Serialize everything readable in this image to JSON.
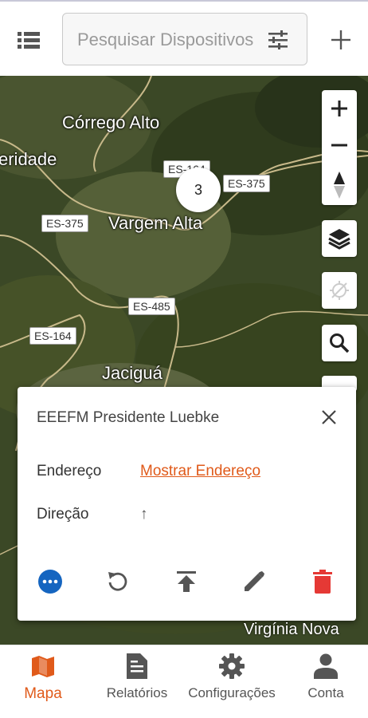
{
  "header": {
    "search_placeholder": "Pesquisar Dispositivos"
  },
  "map": {
    "places": [
      "Córrego Alto",
      "eridade",
      "Vargem Alta",
      "Jaciguá",
      "Virgínia Nova"
    ],
    "roads": [
      "ES-164",
      "ES-375",
      "ES-375",
      "ES-485",
      "ES-164"
    ],
    "cluster_count": "3"
  },
  "popup": {
    "title": "EEEFM Presidente Luebke",
    "rows": [
      {
        "label": "Endereço",
        "value": "Mostrar Endereço"
      },
      {
        "label": "Direção",
        "value": "↑"
      }
    ]
  },
  "colors": {
    "accent": "#e05a1a",
    "more_button": "#1565c0",
    "delete_button": "#e53935"
  },
  "icons": {
    "menu": "list-icon",
    "filter": "tune-icon",
    "add": "plus-icon",
    "close": "close-icon",
    "more": "more-horizontal-icon",
    "refresh": "refresh-icon",
    "upload": "upload-icon",
    "edit": "pencil-icon",
    "delete": "trash-icon"
  },
  "bottom_nav": {
    "items": [
      {
        "label": "Mapa",
        "icon": "map-icon",
        "active": true
      },
      {
        "label": "Relatórios",
        "icon": "document-icon",
        "active": false
      },
      {
        "label": "Configurações",
        "icon": "gear-icon",
        "active": false
      },
      {
        "label": "Conta",
        "icon": "person-icon",
        "active": false
      }
    ]
  }
}
